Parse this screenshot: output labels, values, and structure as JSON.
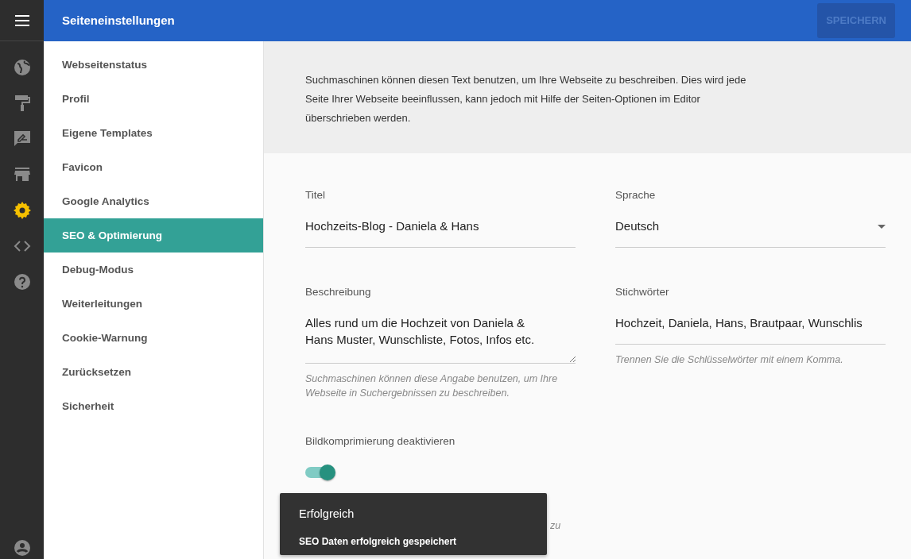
{
  "header": {
    "title": "Seiteneinstellungen",
    "save_button": {
      "label": "SPEICHERN",
      "disabled": true
    }
  },
  "rail": [
    {
      "kind": "globe",
      "selected": false
    },
    {
      "kind": "roller",
      "selected": false
    },
    {
      "kind": "feedback",
      "selected": false
    },
    {
      "kind": "store",
      "selected": false
    },
    {
      "kind": "gear",
      "selected": true
    },
    {
      "kind": "code",
      "selected": false
    },
    {
      "kind": "help",
      "selected": false
    }
  ],
  "submenu": [
    {
      "label": "Webseitenstatus",
      "selected": false
    },
    {
      "label": "Profil",
      "selected": false
    },
    {
      "label": "Eigene Templates",
      "selected": false
    },
    {
      "label": "Favicon",
      "selected": false
    },
    {
      "label": "Google Analytics",
      "selected": false
    },
    {
      "label": "SEO & Optimierung",
      "selected": true
    },
    {
      "label": "Debug-Modus",
      "selected": false
    },
    {
      "label": "Weiterleitungen",
      "selected": false
    },
    {
      "label": "Cookie-Warnung",
      "selected": false
    },
    {
      "label": "Zurücksetzen",
      "selected": false
    },
    {
      "label": "Sicherheit",
      "selected": false
    }
  ],
  "intro": "Suchmaschinen können diesen Text benutzen, um Ihre Webseite zu beschreiben. Dies wird jede Seite Ihrer Webseite beeinflussen, kann jedoch mit Hilfe der Seiten-Optionen im Editor überschrieben werden.",
  "form": {
    "title": {
      "label": "Titel",
      "value": "Hochzeits-Blog - Daniela & Hans"
    },
    "language": {
      "label": "Sprache",
      "value": "Deutsch"
    },
    "description": {
      "label": "Beschreibung",
      "value": "Alles rund um die Hochzeit von Daniela & Hans Muster, Wunschliste, Fotos, Infos etc.",
      "hint": "Suchmaschinen können diese Angabe benutzen, um Ihre Webseite in Suchergebnissen zu beschreiben."
    },
    "keywords": {
      "label": "Stichwörter",
      "value": "Hochzeit, Daniela, Hans, Brautpaar, Wunschlis",
      "hint": "Trennen Sie die Schlüsselwörter mit einem Komma."
    },
    "compression": {
      "label": "Bildkomprimierung deaktivieren",
      "on": true,
      "hint": "zu"
    }
  },
  "toast": {
    "title": "Erfolgreich",
    "message": "SEO Daten erfolgreich gespeichert"
  }
}
